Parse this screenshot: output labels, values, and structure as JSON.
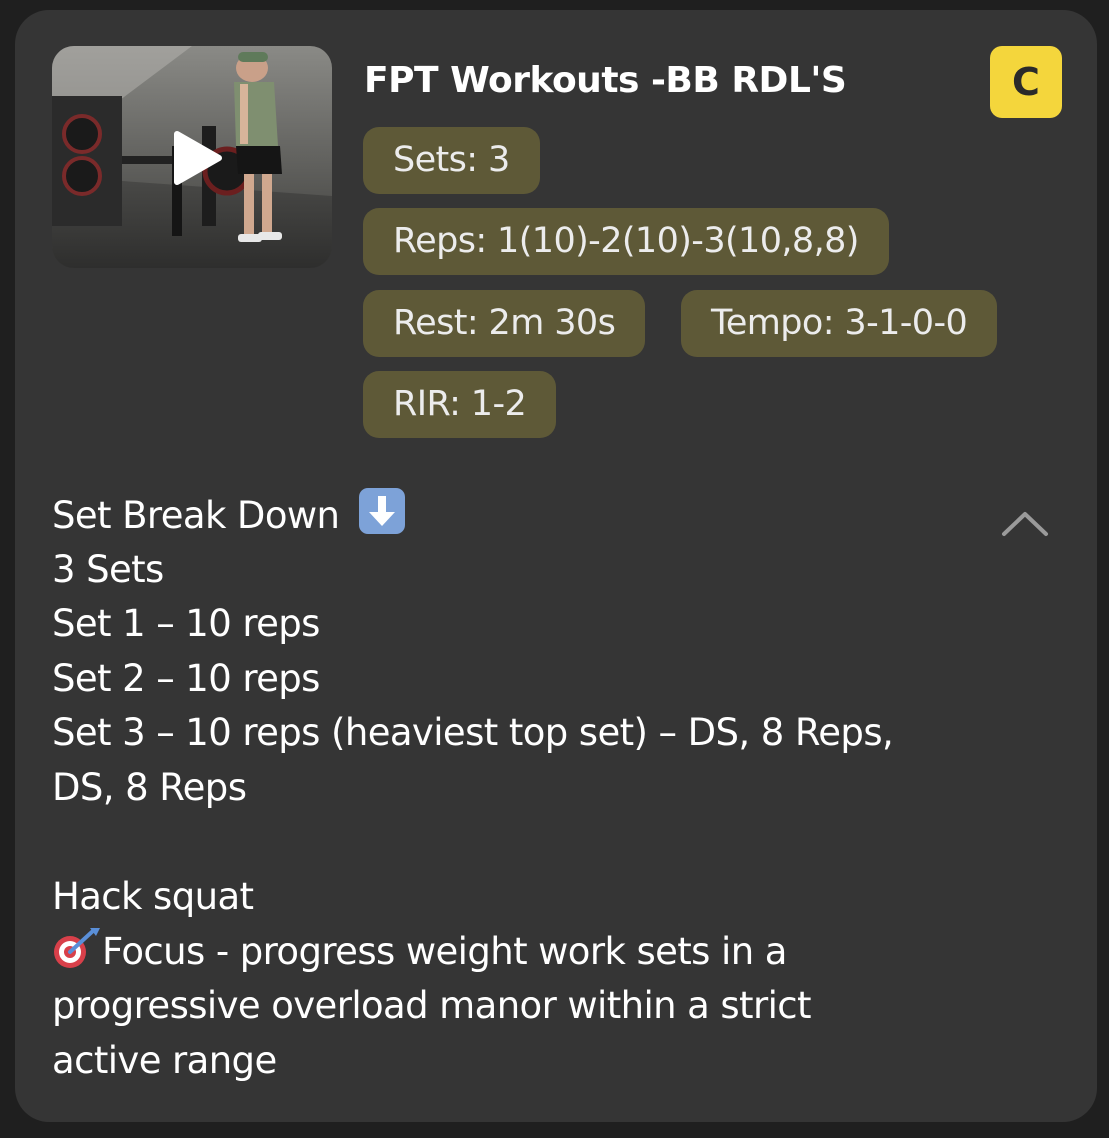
{
  "workout": {
    "title": "FPT Workouts -BB RDL'S",
    "badge_letter": "C",
    "badge_color": "#f4d63c",
    "pill_color": "#5e5937"
  },
  "video": {
    "play_icon": "play-icon"
  },
  "stats": {
    "sets": "Sets: 3",
    "reps": "Reps: 1(10)-2(10)-3(10,8,8)",
    "rest": "Rest: 2m 30s",
    "tempo": "Tempo: 3-1-0-0",
    "rir": "RIR: 1-2"
  },
  "description": {
    "heading": "Set Break Down",
    "heading_icon": "down-arrow-emoji-icon",
    "lines": [
      "3 Sets",
      "Set 1 – 10 reps",
      "Set 2 – 10 reps",
      "Set 3 – 10 reps (heaviest top set) – DS, 8 Reps,",
      "DS, 8 Reps"
    ],
    "exercise": "Hack squat",
    "focus_icon": "target-emoji-icon",
    "focus_lines": [
      "Focus - progress weight work sets in a",
      "progressive overload manor within a strict",
      "active range"
    ],
    "collapse_icon": "chevron-up-icon"
  }
}
